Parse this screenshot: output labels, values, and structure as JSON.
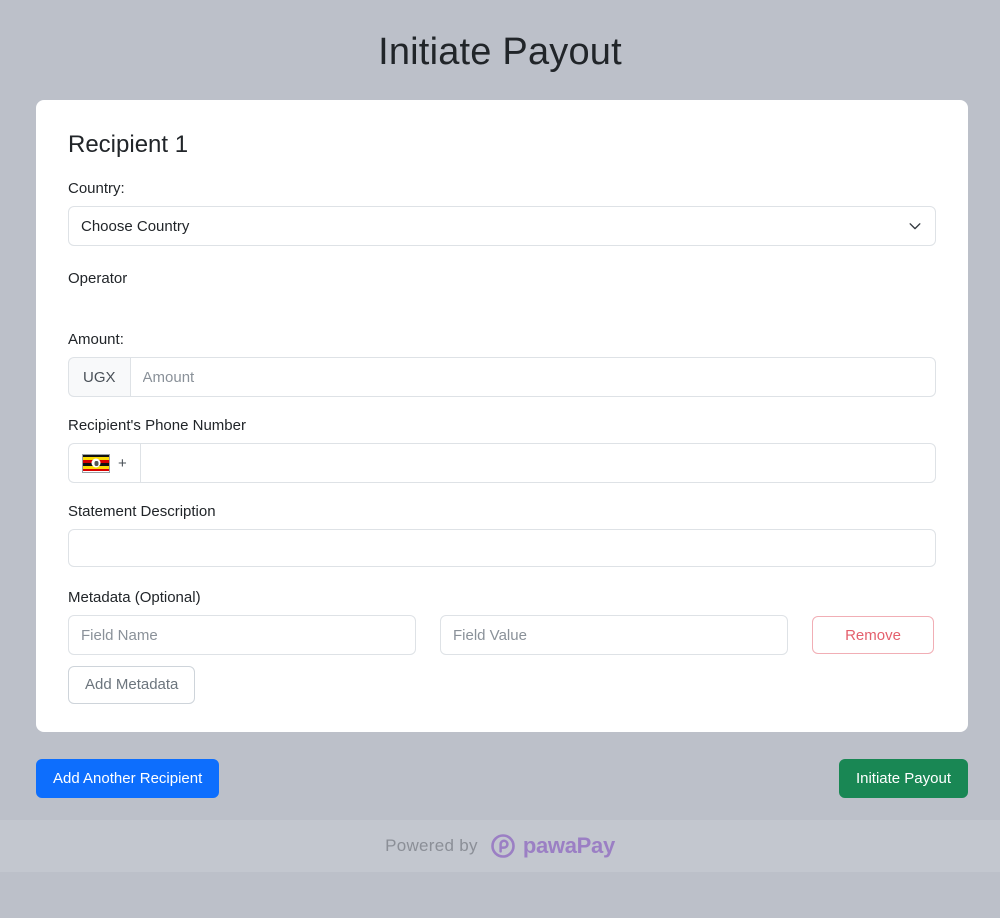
{
  "page": {
    "title": "Initiate Payout",
    "background_color": "#bcc0c9"
  },
  "card": {
    "recipient_heading": "Recipient 1",
    "country": {
      "label": "Country:",
      "selected": "Choose Country",
      "options": [
        "Choose Country"
      ],
      "chevron_icon": "chevron-down-icon"
    },
    "operator": {
      "label": "Operator"
    },
    "amount": {
      "label": "Amount:",
      "currency_prefix": "UGX",
      "value": "",
      "placeholder": "Amount"
    },
    "phone": {
      "label": "Recipient's Phone Number",
      "flag_icon": "uganda-flag-icon",
      "prefix": "+",
      "value": "",
      "placeholder": ""
    },
    "statement": {
      "label": "Statement Description",
      "value": "",
      "placeholder": ""
    },
    "metadata": {
      "label": "Metadata (Optional)",
      "rows": [
        {
          "name_value": "",
          "name_placeholder": "Field Name",
          "value_value": "",
          "value_placeholder": "Field Value",
          "remove_label": "Remove"
        }
      ],
      "add_label": "Add Metadata"
    }
  },
  "actions": {
    "add_recipient_label": "Add Another Recipient",
    "initiate_label": "Initiate Payout",
    "add_recipient_color": "#0d6efd",
    "initiate_color": "#198754"
  },
  "footer": {
    "powered_by": "Powered by",
    "brand_name": "pawaPay",
    "brand_color": "#9b7fc4",
    "brand_icon": "pawapay-logo-icon"
  }
}
